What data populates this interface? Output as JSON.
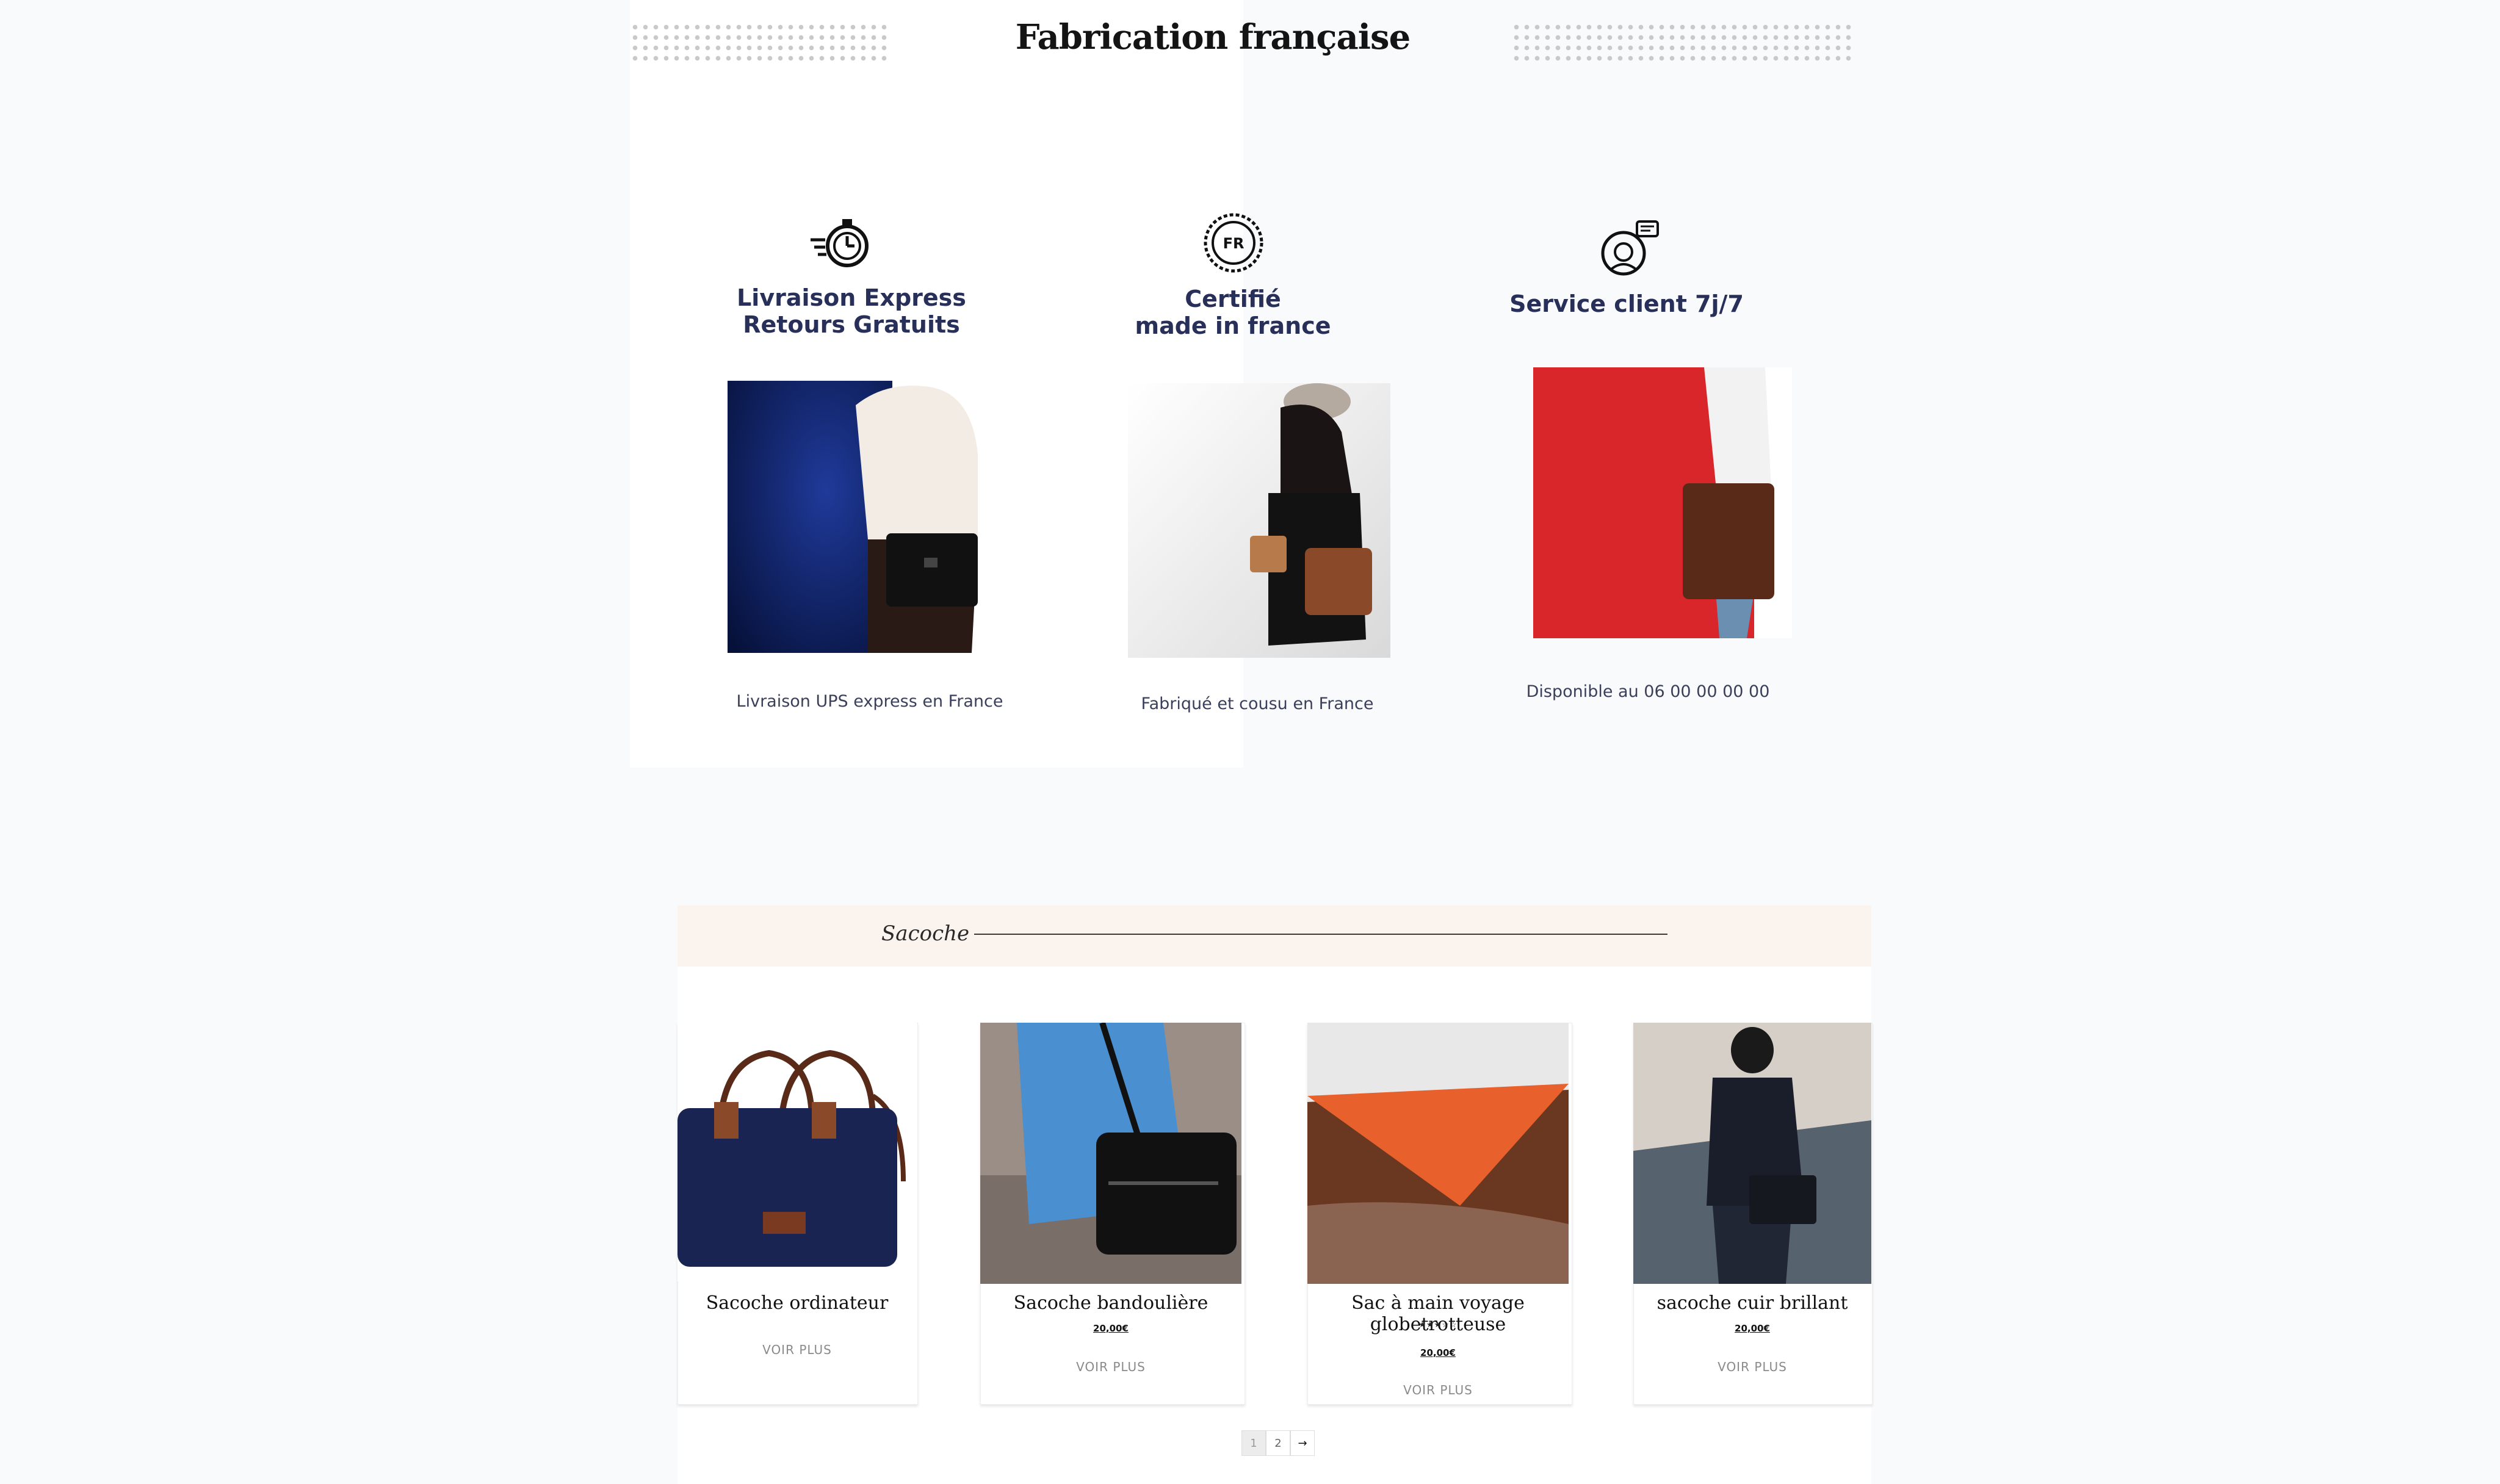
{
  "features_section": {
    "title": "Fabrication française",
    "items": [
      {
        "icon": "stopwatch-icon",
        "title_line1": "Livraison Express",
        "title_line2": "Retours Gratuits",
        "caption": "Livraison UPS express en France"
      },
      {
        "icon": "fr-certification-badge-icon",
        "title_line1": "Certifié",
        "title_line2": "made in france",
        "caption": "Fabriqué et cousu en France"
      },
      {
        "icon": "customer-service-icon",
        "title_line1": "Service client 7j/7",
        "title_line2": "",
        "caption": "Disponible au 06 00 00 00 00"
      }
    ]
  },
  "sacoche": {
    "heading": "Sacoche",
    "products": [
      {
        "name": "Sacoche ordinateur",
        "price": "",
        "rating": null,
        "link": "VOIR PLUS"
      },
      {
        "name": "Sacoche bandoulière",
        "price": "20,00€",
        "rating": null,
        "link": "VOIR PLUS"
      },
      {
        "name": "Sac à main voyage globetrotteuse",
        "price": "20,00€",
        "rating": 3,
        "link": "VOIR PLUS"
      },
      {
        "name": "sacoche cuir brillant",
        "price": "20,00€",
        "rating": null,
        "link": "VOIR PLUS"
      }
    ],
    "pagination": {
      "pages": [
        "1",
        "2"
      ],
      "current": "1",
      "next": "→"
    }
  },
  "colors": {
    "feature_title": "#28305a",
    "header_band": "#fbf3ee",
    "page_bg": "#f9fafc",
    "photo_blue": "#0a1d5c",
    "photo_red": "#d8262b"
  }
}
